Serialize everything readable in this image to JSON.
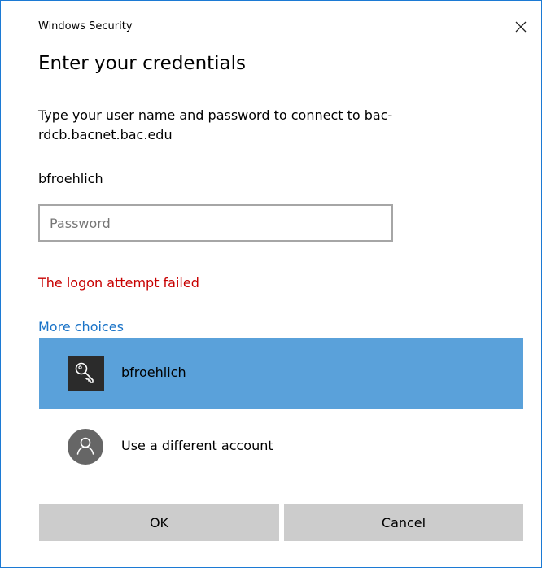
{
  "window": {
    "title": "Windows Security",
    "accent_color": "#1c7ad4"
  },
  "header": {
    "title": "Enter your credentials"
  },
  "prompt": {
    "message": "Type your user name and password to connect to bac-rdcb.bacnet.bac.edu"
  },
  "credentials": {
    "username": "bfroehlich",
    "password_placeholder": "Password",
    "password_value": ""
  },
  "status": {
    "error_text": "The logon attempt failed",
    "error_color": "#c70000"
  },
  "more_choices": {
    "link_label": "More choices",
    "options": [
      {
        "label": "bfroehlich",
        "icon": "key-icon",
        "selected": true
      },
      {
        "label": "Use a different account",
        "icon": "user-icon",
        "selected": false
      }
    ],
    "selected_color": "#5aa1da"
  },
  "buttons": {
    "ok_label": "OK",
    "cancel_label": "Cancel"
  }
}
